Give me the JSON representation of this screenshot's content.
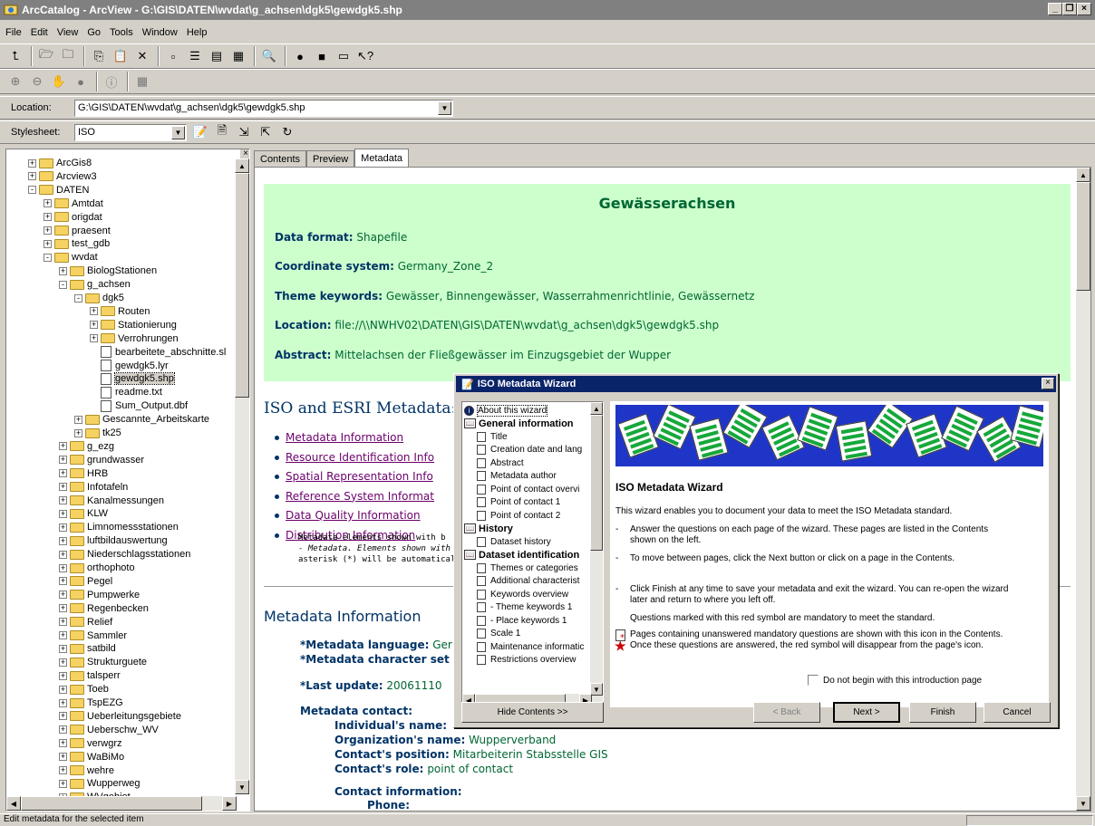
{
  "window": {
    "title": "ArcCatalog - ArcView - G:\\GIS\\DATEN\\wvdat\\g_achsen\\dgk5\\gewdgk5.shp"
  },
  "menu": [
    "File",
    "Edit",
    "View",
    "Go",
    "Tools",
    "Window",
    "Help"
  ],
  "location": {
    "label": "Location:",
    "value": "G:\\GIS\\DATEN\\wvdat\\g_achsen\\dgk5\\gewdgk5.shp"
  },
  "stylesheet": {
    "label": "Stylesheet:",
    "value": "ISO"
  },
  "tree": [
    {
      "label": "ArcGis8",
      "indent": 1,
      "kind": "folder",
      "exp": "+"
    },
    {
      "label": "Arcview3",
      "indent": 1,
      "kind": "folder",
      "exp": "+"
    },
    {
      "label": "DATEN",
      "indent": 1,
      "kind": "folder",
      "exp": "-"
    },
    {
      "label": "Amtdat",
      "indent": 2,
      "kind": "folder",
      "exp": "+"
    },
    {
      "label": "origdat",
      "indent": 2,
      "kind": "folder",
      "exp": "+"
    },
    {
      "label": "praesent",
      "indent": 2,
      "kind": "folder",
      "exp": "+"
    },
    {
      "label": "test_gdb",
      "indent": 2,
      "kind": "folder",
      "exp": "+"
    },
    {
      "label": "wvdat",
      "indent": 2,
      "kind": "folder",
      "exp": "-"
    },
    {
      "label": "BiologStationen",
      "indent": 3,
      "kind": "folder",
      "exp": "+"
    },
    {
      "label": "g_achsen",
      "indent": 3,
      "kind": "folder",
      "exp": "-"
    },
    {
      "label": "dgk5",
      "indent": 4,
      "kind": "folder",
      "exp": "-"
    },
    {
      "label": "Routen",
      "indent": 5,
      "kind": "folder",
      "exp": "+"
    },
    {
      "label": "Stationierung",
      "indent": 5,
      "kind": "folder",
      "exp": "+"
    },
    {
      "label": "Verrohrungen",
      "indent": 5,
      "kind": "folder",
      "exp": "+"
    },
    {
      "label": "bearbeitete_abschnitte.sl",
      "indent": 5,
      "kind": "file",
      "exp": ""
    },
    {
      "label": "gewdgk5.lyr",
      "indent": 5,
      "kind": "file",
      "exp": ""
    },
    {
      "label": "gewdgk5.shp",
      "indent": 5,
      "kind": "file",
      "exp": "",
      "selected": true
    },
    {
      "label": "readme.txt",
      "indent": 5,
      "kind": "file",
      "exp": ""
    },
    {
      "label": "Sum_Output.dbf",
      "indent": 5,
      "kind": "file",
      "exp": ""
    },
    {
      "label": "Gescannte_Arbeitskarte",
      "indent": 4,
      "kind": "folder",
      "exp": "+"
    },
    {
      "label": "tk25",
      "indent": 4,
      "kind": "folder",
      "exp": "+"
    },
    {
      "label": "g_ezg",
      "indent": 3,
      "kind": "folder",
      "exp": "+"
    },
    {
      "label": "grundwasser",
      "indent": 3,
      "kind": "folder",
      "exp": "+"
    },
    {
      "label": "HRB",
      "indent": 3,
      "kind": "folder",
      "exp": "+"
    },
    {
      "label": "Infotafeln",
      "indent": 3,
      "kind": "folder",
      "exp": "+"
    },
    {
      "label": "Kanalmessungen",
      "indent": 3,
      "kind": "folder",
      "exp": "+"
    },
    {
      "label": "KLW",
      "indent": 3,
      "kind": "folder",
      "exp": "+"
    },
    {
      "label": "Limnomessstationen",
      "indent": 3,
      "kind": "folder",
      "exp": "+"
    },
    {
      "label": "luftbildauswertung",
      "indent": 3,
      "kind": "folder",
      "exp": "+"
    },
    {
      "label": "Niederschlagsstationen",
      "indent": 3,
      "kind": "folder",
      "exp": "+"
    },
    {
      "label": "orthophoto",
      "indent": 3,
      "kind": "folder",
      "exp": "+"
    },
    {
      "label": "Pegel",
      "indent": 3,
      "kind": "folder",
      "exp": "+"
    },
    {
      "label": "Pumpwerke",
      "indent": 3,
      "kind": "folder",
      "exp": "+"
    },
    {
      "label": "Regenbecken",
      "indent": 3,
      "kind": "folder",
      "exp": "+"
    },
    {
      "label": "Relief",
      "indent": 3,
      "kind": "folder",
      "exp": "+"
    },
    {
      "label": "Sammler",
      "indent": 3,
      "kind": "folder",
      "exp": "+"
    },
    {
      "label": "satbild",
      "indent": 3,
      "kind": "folder",
      "exp": "+"
    },
    {
      "label": "Strukturguete",
      "indent": 3,
      "kind": "folder",
      "exp": "+"
    },
    {
      "label": "talsperr",
      "indent": 3,
      "kind": "folder",
      "exp": "+"
    },
    {
      "label": "Toeb",
      "indent": 3,
      "kind": "folder",
      "exp": "+"
    },
    {
      "label": "TspEZG",
      "indent": 3,
      "kind": "folder",
      "exp": "+"
    },
    {
      "label": "Ueberleitungsgebiete",
      "indent": 3,
      "kind": "folder",
      "exp": "+"
    },
    {
      "label": "Ueberschw_WV",
      "indent": 3,
      "kind": "folder",
      "exp": "+"
    },
    {
      "label": "verwgrz",
      "indent": 3,
      "kind": "folder",
      "exp": "+"
    },
    {
      "label": "WaBiMo",
      "indent": 3,
      "kind": "folder",
      "exp": "+"
    },
    {
      "label": "wehre",
      "indent": 3,
      "kind": "folder",
      "exp": "+"
    },
    {
      "label": "Wupperweg",
      "indent": 3,
      "kind": "folder",
      "exp": "+"
    },
    {
      "label": "WVgebiet",
      "indent": 3,
      "kind": "folder",
      "exp": "+"
    }
  ],
  "tabs": [
    "Contents",
    "Preview",
    "Metadata"
  ],
  "meta": {
    "title": "Gewässerachsen",
    "data_format_label": "Data format:",
    "data_format": "Shapefile",
    "coord_label": "Coordinate system:",
    "coord": "Germany_Zone_2",
    "theme_label": "Theme keywords:",
    "theme": "Gewässer, Binnengewässer, Wasserrahmenrichtlinie, Gewässernetz",
    "location_label": "Location:",
    "location": "file://\\\\NWHV02\\DATEN\\GIS\\DATEN\\wvdat\\g_achsen\\dgk5\\gewdgk5.shp",
    "abstract_label": "Abstract:",
    "abstract": "Mittelachsen der Fließgewässer im Einzugsgebiet der Wupper",
    "iso_header": "ISO and ESRI Metadata:",
    "links": [
      "Metadata Information",
      "Resource Identification Info",
      "Spatial Representation Info",
      "Reference System Informat",
      "Data Quality Information",
      "Distribution Information"
    ],
    "small1": "Metadata elements shown with b",
    "small2": "- Metadata. Elements shown with",
    "small3": "asterisk (*) will be automatically",
    "mi_header": "Metadata Information",
    "lang_label": "*Metadata language:",
    "lang": "Ger",
    "charset_label": "*Metadata character set",
    "update_label": "*Last update:",
    "update": "20061110",
    "contact_label": "Metadata contact:",
    "indiv_label": "Individual's name:",
    "org_label": "Organization's name:",
    "org": "Wupperverband",
    "pos_label": "Contact's position:",
    "pos": "Mitarbeiterin Stabsstelle GIS",
    "role_label": "Contact's role:",
    "role": "point of contact",
    "ci_label": "Contact information:",
    "phone_label": "Phone:"
  },
  "wizard": {
    "title": "ISO Metadata Wizard",
    "tree": [
      {
        "label": "About this wizard",
        "kind": "info",
        "bold": false,
        "indent": 0
      },
      {
        "label": "General information",
        "kind": "book",
        "bold": true,
        "indent": 0
      },
      {
        "label": "Title",
        "kind": "page",
        "bold": false,
        "indent": 1
      },
      {
        "label": "Creation date and lang",
        "kind": "page",
        "bold": false,
        "indent": 1
      },
      {
        "label": "Abstract",
        "kind": "page",
        "bold": false,
        "indent": 1
      },
      {
        "label": "Metadata author",
        "kind": "page",
        "bold": false,
        "indent": 1
      },
      {
        "label": "Point of contact overvi",
        "kind": "page",
        "bold": false,
        "indent": 1
      },
      {
        "label": "Point of contact 1",
        "kind": "page",
        "bold": false,
        "indent": 1
      },
      {
        "label": "Point of contact 2",
        "kind": "page",
        "bold": false,
        "indent": 1
      },
      {
        "label": "History",
        "kind": "book",
        "bold": true,
        "indent": 0
      },
      {
        "label": "Dataset history",
        "kind": "page",
        "bold": false,
        "indent": 1
      },
      {
        "label": "Dataset identification",
        "kind": "book",
        "bold": true,
        "indent": 0
      },
      {
        "label": "Themes or categories",
        "kind": "page",
        "bold": false,
        "indent": 1
      },
      {
        "label": "Additional characterist",
        "kind": "page",
        "bold": false,
        "indent": 1
      },
      {
        "label": "Keywords overview",
        "kind": "page",
        "bold": false,
        "indent": 1
      },
      {
        "label": "- Theme keywords 1",
        "kind": "page",
        "bold": false,
        "indent": 1
      },
      {
        "label": "- Place keywords 1",
        "kind": "page",
        "bold": false,
        "indent": 1
      },
      {
        "label": "Scale 1",
        "kind": "page",
        "bold": false,
        "indent": 1
      },
      {
        "label": "Maintenance informatic",
        "kind": "page",
        "bold": false,
        "indent": 1
      },
      {
        "label": "Restrictions overview",
        "kind": "page",
        "bold": false,
        "indent": 1
      }
    ],
    "heading": "ISO Metadata Wizard",
    "intro": "This wizard enables you to document your data to meet the ISO Metadata standard.",
    "item1a": "Answer the questions on each page of the wizard.  These pages are listed in the Contents",
    "item1b": "shown on the left.",
    "item2": "To move between pages, click the Next button or click on a page in the Contents.",
    "item3a": "Click Finish at any time to save your metadata and exit the wizard.  You can re-open the wizard",
    "item3b": "later and return to where you left off.",
    "item4": "Questions marked with this red symbol are mandatory to meet the standard.",
    "item5a": "Pages containing unanswered mandatory questions are shown with this icon in the Contents.",
    "item5b": "Once these questions are answered, the red symbol will disappear from the page's icon.",
    "checkbox": "Do not begin with this introduction page",
    "hide_btn": "Hide Contents >>",
    "back_btn": "< Back",
    "next_btn": "Next >",
    "finish_btn": "Finish",
    "cancel_btn": "Cancel"
  },
  "status": "Edit metadata for the selected item"
}
